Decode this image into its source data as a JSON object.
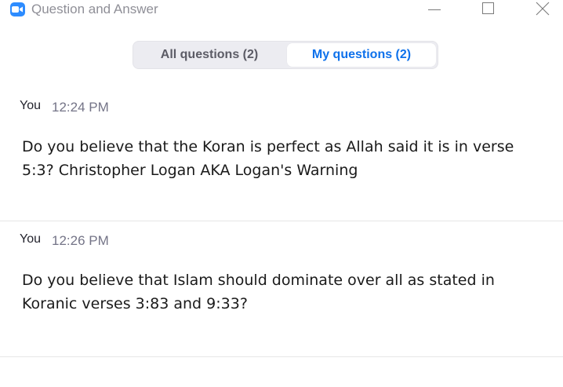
{
  "window": {
    "title": "Question and Answer"
  },
  "tabs": [
    {
      "label": "All questions (2)",
      "selected": false
    },
    {
      "label": "My questions (2)",
      "selected": true
    }
  ],
  "questions": [
    {
      "author": "You",
      "time": "12:24 PM",
      "text": "Do you believe that the Koran is perfect as Allah said it is in verse 5:3? Christopher Logan AKA Logan's Warning"
    },
    {
      "author": "You",
      "time": "12:26 PM",
      "text": "Do you believe that Islam should dominate over all as stated in Koranic verses 3:83 and 9:33?"
    }
  ],
  "icons": {
    "app": "zoom-video-camera-icon",
    "minimize": "minimize-icon",
    "maximize": "maximize-icon",
    "close": "close-icon"
  },
  "colors": {
    "accent": "#0e71eb",
    "app_icon": "#2d8cff",
    "tab_background": "#ececf1",
    "divider": "#e6e6e6"
  }
}
